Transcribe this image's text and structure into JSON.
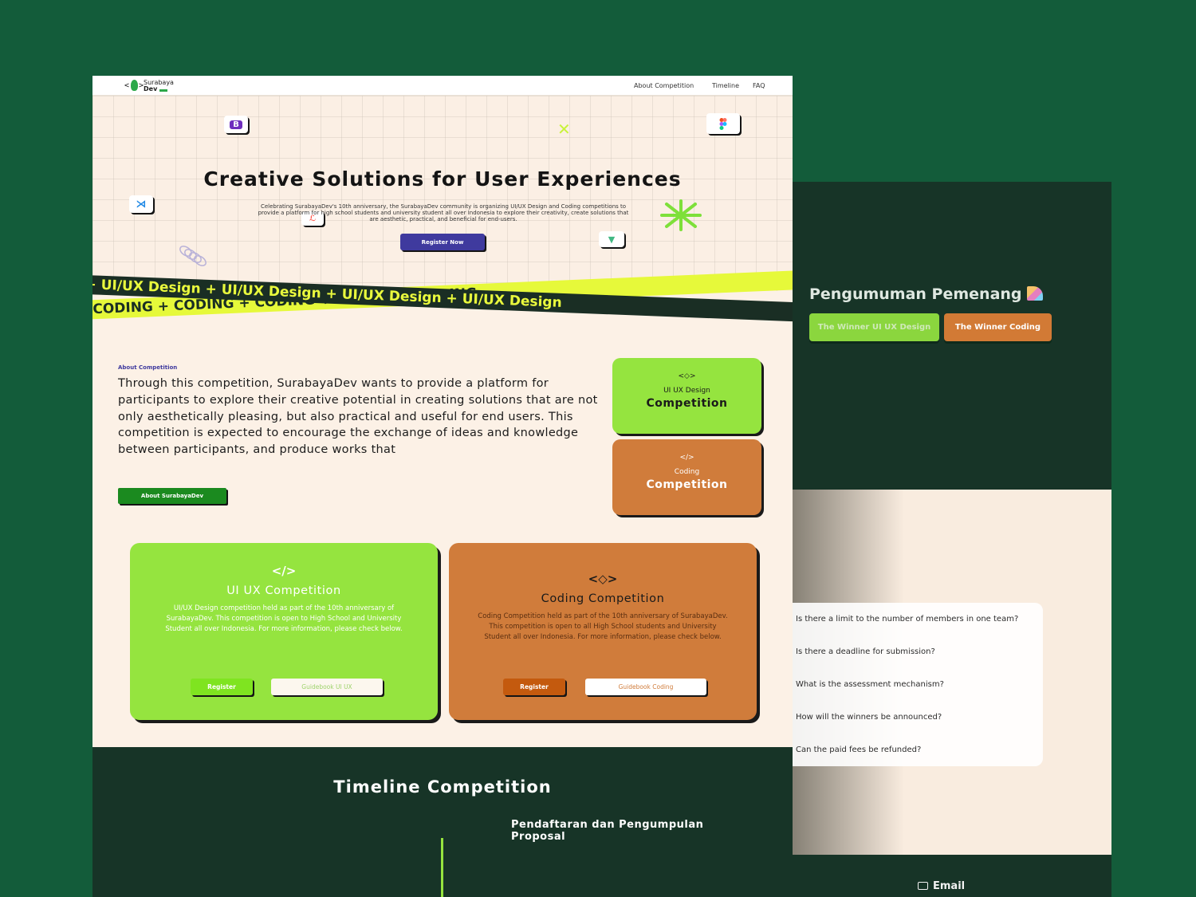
{
  "back": {
    "winner_title": "Pengumuman Pemenang",
    "winner_ui_btn": "The Winner UI UX Design",
    "winner_code_btn": "The Winner Coding",
    "faq": [
      "Is there a limit to the number of members in one team?",
      "Is there a deadline for submission?",
      "What is the assessment mechanism?",
      "How will the winners be announced?",
      "Can the paid fees be refunded?"
    ],
    "email_label": "Email"
  },
  "nav": {
    "logo_line1": "Surabaya",
    "logo_line2": "Dev",
    "links": [
      "About Competition",
      "Timeline",
      "FAQ"
    ]
  },
  "hero": {
    "title": "Creative Solutions for User Experiences",
    "subtitle": "Celebrating SurabayaDev's 10th anniversary, the SurabayaDev community is organizing UI/UX Design and Coding competitions to provide a platform for high school students and university student all over Indonesia to explore their creativity, create solutions that are aesthetic, practical, and beneficial for end-users.",
    "register_label": "Register Now"
  },
  "ribbons": {
    "dark": "gn  + UI/UX Design  + UI/UX Design  + UI/UX Design  + UI/UX Design",
    "yellow": "G  + CODING  + CODING  + CODING  + CODING  + CODING"
  },
  "about": {
    "label": "About Competition",
    "text": "Through this competition, SurabayaDev wants to provide a platform for participants to explore their creative potential in creating solutions that are not only aesthetically pleasing, but also practical and useful for end users. This competition is expected to encourage the exchange of ideas and knowledge between participants, and produce works that",
    "button": "About SurabayaDev"
  },
  "mini_cards": {
    "ui": {
      "small": "UI UX Design",
      "large": "Competition"
    },
    "code": {
      "small": "Coding",
      "large": "Competition"
    }
  },
  "cards": {
    "ui": {
      "title": "UI UX Competition",
      "desc": "UI/UX Design competition held as part of the 10th anniversary of SurabayaDev. This competition is open to High School and University Student all over Indonesia. For more information, please check below.",
      "register": "Register",
      "guide": "Guidebook UI UX"
    },
    "code": {
      "title": "Coding Competition",
      "desc": "Coding Competition held as part of the 10th anniversary of SurabayaDev. This competition is open to all High School students and University Student all over Indonesia. For more information, please check below.",
      "register": "Register",
      "guide": "Guidebook Coding"
    }
  },
  "timeline": {
    "title": "Timeline Competition",
    "date": "",
    "item": "Pendaftaran dan Pengumpulan Proposal"
  },
  "colors": {
    "bg_green": "#135c3a",
    "dark_green": "#173427",
    "lime": "#95e43f",
    "orange": "#d07c3b",
    "purple": "#3f3a9e",
    "yellow": "#e6f93a"
  }
}
